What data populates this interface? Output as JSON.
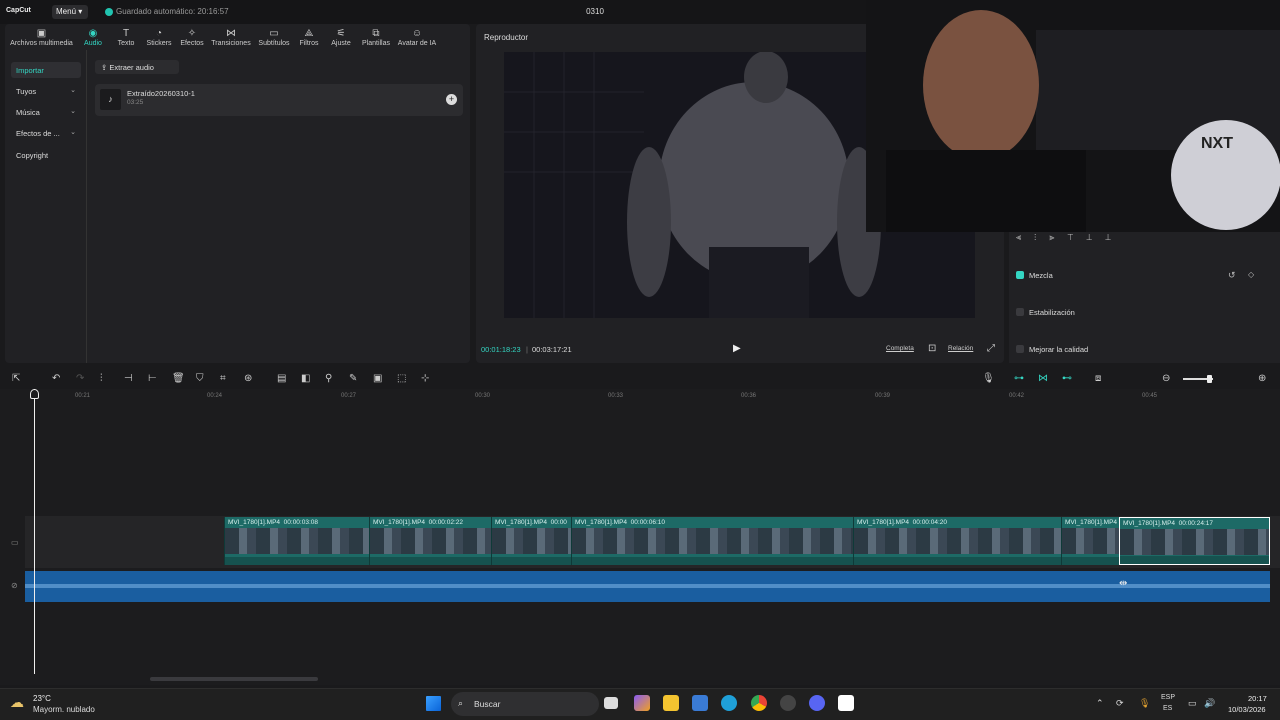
{
  "app": {
    "logo": "CapCut",
    "menu": "Menú",
    "autosave": "Guardado automático: 20:16:57",
    "project_title": "0310"
  },
  "tabs": [
    {
      "label": "Archivos multimedia",
      "icon": "media-icon"
    },
    {
      "label": "Audio",
      "icon": "audio-icon",
      "active": true
    },
    {
      "label": "Texto",
      "icon": "text-icon"
    },
    {
      "label": "Stickers",
      "icon": "sticker-icon"
    },
    {
      "label": "Efectos",
      "icon": "effects-icon"
    },
    {
      "label": "Transiciones",
      "icon": "transition-icon"
    },
    {
      "label": "Subtítulos",
      "icon": "subtitle-icon"
    },
    {
      "label": "Filtros",
      "icon": "filter-icon"
    },
    {
      "label": "Ajuste",
      "icon": "adjust-icon"
    },
    {
      "label": "Plantillas",
      "icon": "template-icon"
    },
    {
      "label": "Avatar de IA",
      "icon": "avatar-icon"
    }
  ],
  "sidebar": [
    {
      "label": "Importar",
      "active": true
    },
    {
      "label": "Tuyos"
    },
    {
      "label": "Música"
    },
    {
      "label": "Efectos de ..."
    },
    {
      "label": "Copyright"
    }
  ],
  "media": {
    "extract_label": "Extraer audio",
    "item_name": "Extraído20260310-1",
    "item_duration": "03:25"
  },
  "player": {
    "title": "Reproductor",
    "current_time": "00:01:18:23",
    "total_time": "00:03:17:21",
    "full_label": "Completa",
    "ratio_label": "Relación"
  },
  "props": {
    "blend": "Mezcla",
    "stabilize": "Estabilización",
    "enhance": "Mejorar la calidad"
  },
  "ruler": [
    "00:21",
    "00:24",
    "00:27",
    "00:30",
    "00:33",
    "00:36",
    "00:39",
    "00:42",
    "00:45"
  ],
  "clips": [
    {
      "name": "MVI_1780[1].MP4",
      "duration": "00:00:03:08"
    },
    {
      "name": "MVI_1780[1].MP4",
      "duration": "00:00:02:22"
    },
    {
      "name": "MVI_1780[1].MP4",
      "duration": "00:00"
    },
    {
      "name": "MVI_1780[1].MP4",
      "duration": "00:00:06:10"
    },
    {
      "name": "MVI_1780[1].MP4",
      "duration": "00:00:04:20"
    },
    {
      "name": "MVI_1780[1].MP4",
      "duration": ""
    },
    {
      "name": "MVI_1780[1].MP4",
      "duration": "00:00:24:17"
    }
  ],
  "taskbar": {
    "temp": "23°C",
    "weather": "Mayorm. nublado",
    "search": "Buscar",
    "lang1": "ESP",
    "lang2": "ES",
    "time": "20:17",
    "date": "10/03/2026"
  },
  "colors": {
    "accent": "#34d6c3",
    "clip": "#1d6a66",
    "audio": "#1a5ea0"
  }
}
